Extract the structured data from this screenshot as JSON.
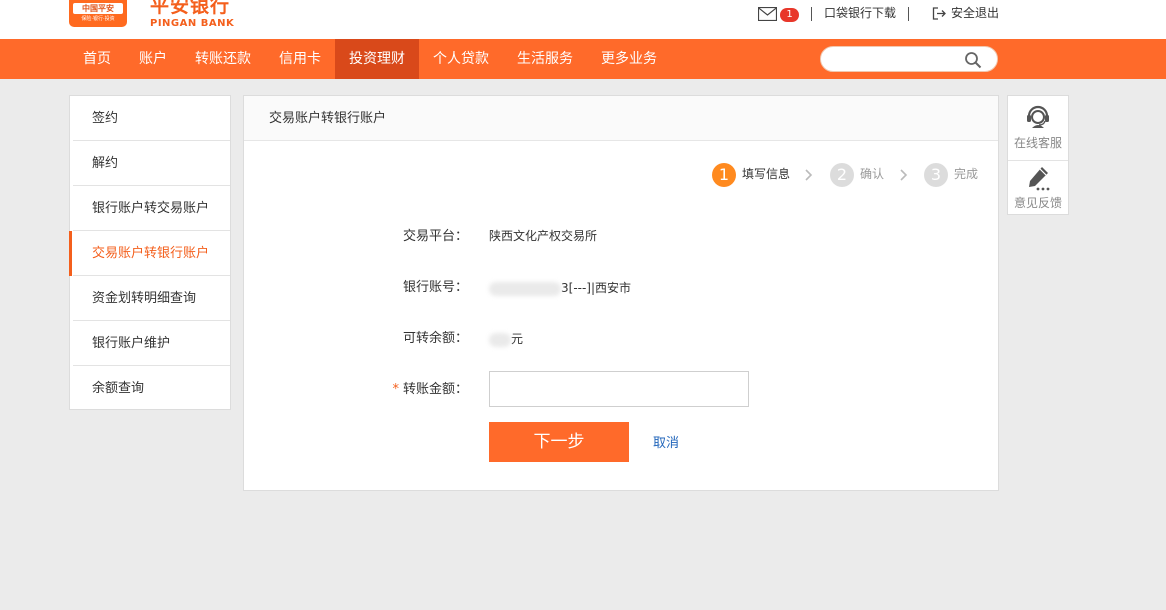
{
  "header": {
    "logo_text": "中国平安",
    "logo_sub": "保险·银行·投资",
    "brand_cn": "平安银行",
    "brand_en": "PINGAN BANK",
    "message_count": "1",
    "app_download": "口袋银行下载",
    "logout": "安全退出"
  },
  "nav": {
    "items": [
      "首页",
      "账户",
      "转账还款",
      "信用卡",
      "投资理财",
      "个人贷款",
      "生活服务",
      "更多业务"
    ],
    "active_index": 4,
    "search_placeholder": ""
  },
  "sidebar": {
    "items": [
      "签约",
      "解约",
      "银行账户转交易账户",
      "交易账户转银行账户",
      "资金划转明细查询",
      "银行账户维护",
      "余额查询"
    ],
    "active_index": 3
  },
  "panel": {
    "title": "交易账户转银行账户",
    "steps": [
      {
        "num": "1",
        "label": "填写信息",
        "active": true
      },
      {
        "num": "2",
        "label": "确认",
        "active": false
      },
      {
        "num": "3",
        "label": "完成",
        "active": false
      }
    ],
    "form": {
      "platform_label": "交易平台：",
      "platform_value": "陕西文化产权交易所",
      "account_label": "银行账号：",
      "account_value_suffix": "3[---]|西安市",
      "balance_label": "可转余额：",
      "balance_unit": "元",
      "amount_required": "*",
      "amount_label": "转账金额：",
      "amount_value": "",
      "next_button": "下一步",
      "cancel": "取消"
    }
  },
  "tools": {
    "service": "在线客服",
    "feedback": "意见反馈"
  },
  "colors": {
    "brand_orange": "#ff6a2a",
    "nav_active": "#d9491a",
    "step_active": "#ff8a1f",
    "link_blue": "#2266bb"
  }
}
